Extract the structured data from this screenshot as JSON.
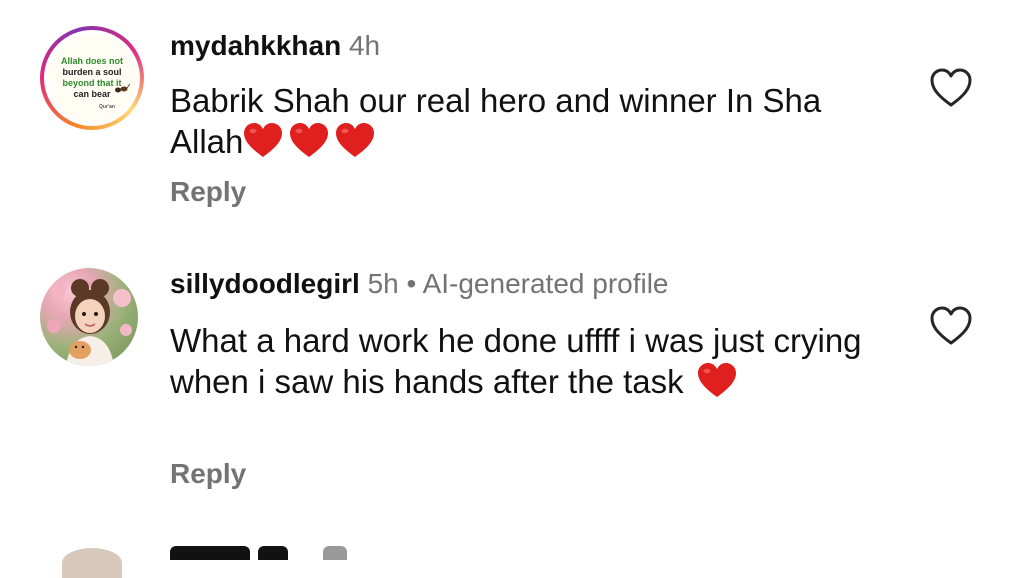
{
  "comments": [
    {
      "username": "mydahkkhan",
      "time": "4h",
      "text": "Babrik Shah our real hero and winner In Sha Allah",
      "emoji_count": 3,
      "reply_label": "Reply",
      "avatar_text": [
        "Allah does not",
        "burden a soul",
        "beyond that it",
        "can bear",
        "Qur'an"
      ]
    },
    {
      "username": "sillydoodlegirl",
      "time": "5h",
      "separator": "•",
      "badge": "AI-generated profile",
      "text": "What a hard work he done uffff i was just crying when i saw his hands after the task",
      "emoji_count": 1,
      "reply_label": "Reply"
    }
  ],
  "icons": {
    "like": "heart-outline-icon",
    "emoji": "red-heart-emoji"
  },
  "colors": {
    "heart_emoji": "#e0201f",
    "muted_text": "#737373"
  }
}
